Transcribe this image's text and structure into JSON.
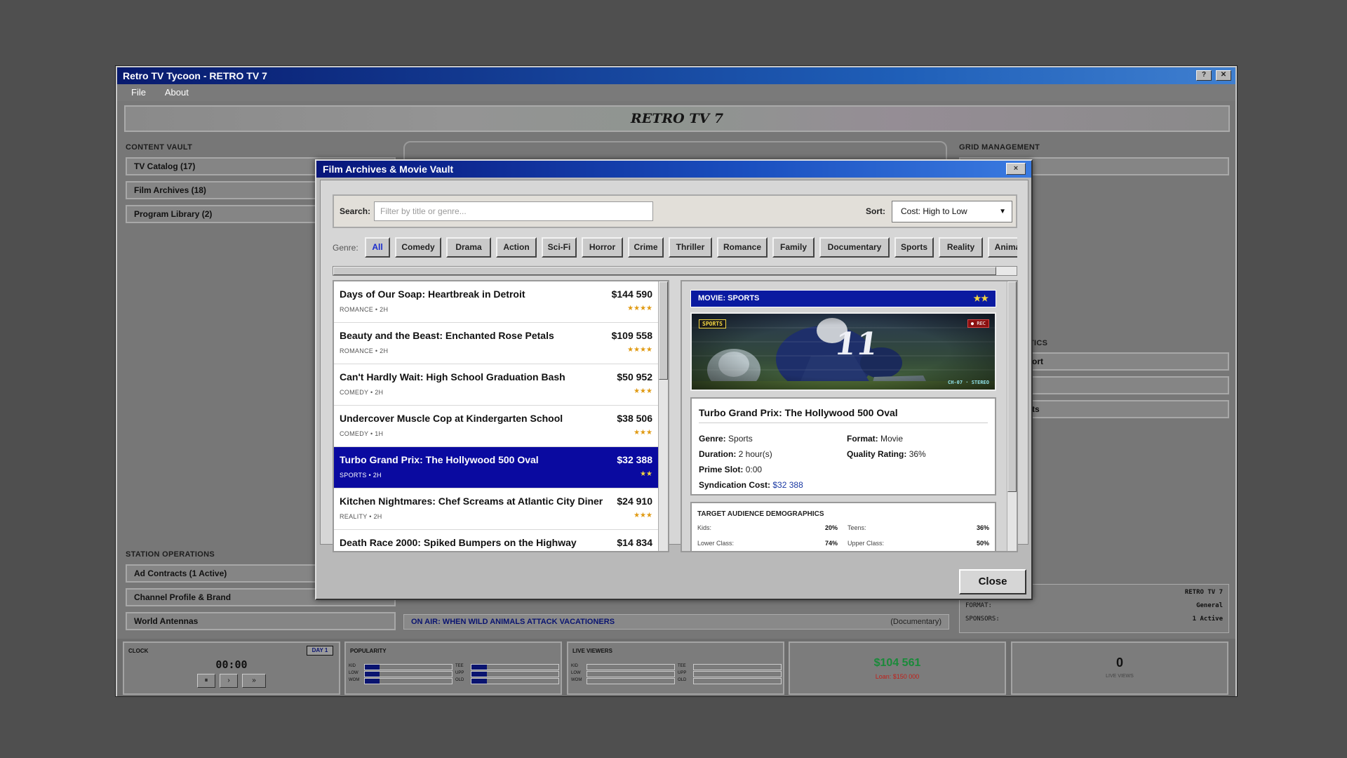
{
  "window": {
    "title": "Retro TV Tycoon - RETRO TV 7"
  },
  "menu": [
    "File",
    "About"
  ],
  "banner": {
    "title": "RETRO TV 7"
  },
  "content_vault": {
    "heading": "CONTENT VAULT",
    "items": [
      "TV Catalog (17)",
      "Film Archives (18)",
      "Program Library (2)"
    ]
  },
  "grid_management": {
    "heading": "GRID MANAGEMENT"
  },
  "statistics": {
    "heading_fragment": "TICS",
    "item1": "ort",
    "item3": "ts"
  },
  "station_operations": {
    "heading": "STATION OPERATIONS",
    "items": [
      "Ad Contracts (1 Active)",
      "Channel Profile & Brand",
      "World Antennas"
    ]
  },
  "on_air": {
    "text": "ON AIR: WHEN WILD ANIMALS ATTACK VACATIONERS",
    "category": "(Documentary)"
  },
  "station_info": {
    "name_value": "RETRO TV 7",
    "format_label": "FORMAT:",
    "format_value": "General",
    "sponsors_label": "SPONSORS:",
    "sponsors_value": "1 Active"
  },
  "status": {
    "clock": {
      "label": "CLOCK",
      "day": "DAY 1",
      "time": "00:00",
      "controls": [
        "⏸",
        "›",
        "»"
      ]
    },
    "popularity": {
      "label": "POPULARITY",
      "bars": [
        {
          "label": "KID",
          "level": 0.17
        },
        {
          "label": "TEE",
          "level": 0.18
        },
        {
          "label": "LOW",
          "level": 0.17
        },
        {
          "label": "UPP",
          "level": 0.18
        },
        {
          "label": "WOM",
          "level": 0.17
        },
        {
          "label": "OLD",
          "level": 0.18
        }
      ]
    },
    "live_viewers": {
      "label": "LIVE VIEWERS",
      "bars": [
        {
          "label": "KID",
          "level": 0
        },
        {
          "label": "TEE",
          "level": 0
        },
        {
          "label": "LOW",
          "level": 0
        },
        {
          "label": "UPP",
          "level": 0
        },
        {
          "label": "WOM",
          "level": 0
        },
        {
          "label": "OLD",
          "level": 0
        }
      ]
    },
    "money": {
      "value": "$104 561",
      "loan": "Loan: $150 000"
    },
    "views": {
      "value": "0",
      "label": "LIVE VIEWS"
    }
  },
  "modal": {
    "title": "Film Archives & Movie Vault",
    "close_x": "×",
    "search_label": "Search:",
    "search_placeholder": "Filter by title or genre...",
    "sort_label": "Sort:",
    "sort_value": "Cost: High to Low",
    "genre_label": "Genre:",
    "genres": [
      "All",
      "Comedy",
      "Drama",
      "Action",
      "Sci-Fi",
      "Horror",
      "Crime",
      "Thriller",
      "Romance",
      "Family",
      "Documentary",
      "Sports",
      "Reality",
      "Animat"
    ],
    "active_genre": "All",
    "films": [
      {
        "title": "Days of Our Soap: Heartbreak in Detroit",
        "meta": "ROMANCE • 2H",
        "price": "$144 590",
        "stars": "★★★★"
      },
      {
        "title": "Beauty and the Beast: Enchanted Rose Petals",
        "meta": "ROMANCE • 2H",
        "price": "$109 558",
        "stars": "★★★★"
      },
      {
        "title": "Can't Hardly Wait: High School Graduation Bash",
        "meta": "COMEDY • 2H",
        "price": "$50 952",
        "stars": "★★★"
      },
      {
        "title": "Undercover Muscle Cop at Kindergarten School",
        "meta": "COMEDY • 1H",
        "price": "$38 506",
        "stars": "★★★"
      },
      {
        "title": "Turbo Grand Prix: The Hollywood 500 Oval",
        "meta": "SPORTS • 2H",
        "price": "$32 388",
        "stars": "★★"
      },
      {
        "title": "Kitchen Nightmares: Chef Screams at Atlantic City Diner",
        "meta": "REALITY • 2H",
        "price": "$24 910",
        "stars": "★★★"
      },
      {
        "title": "Death Race 2000: Spiked Bumpers on the Highway",
        "meta": "",
        "price": "$14 834",
        "stars": ""
      }
    ],
    "selected_index": 4,
    "detail": {
      "header": "MOVIE: SPORTS",
      "stars": "★★",
      "image_tag": "SPORTS",
      "image_rec": "● REC",
      "image_channel": "CH-07 · STEREO",
      "jersey_number": "11",
      "name": "Turbo Grand Prix: The Hollywood 500 Oval",
      "genre_label": "Genre:",
      "genre": "Sports",
      "format_label": "Format:",
      "format": "Movie",
      "duration_label": "Duration:",
      "duration": "2 hour(s)",
      "quality_label": "Quality Rating:",
      "quality": "36%",
      "prime_label": "Prime Slot:",
      "prime": "0:00",
      "cost_label": "Syndication Cost:",
      "cost": "$32 388",
      "demographics_heading": "TARGET AUDIENCE DEMOGRAPHICS",
      "demographics": [
        {
          "label": "Kids:",
          "value": "20%"
        },
        {
          "label": "Teens:",
          "value": "36%"
        },
        {
          "label": "Lower Class:",
          "value": "74%"
        },
        {
          "label": "Upper Class:",
          "value": "50%"
        }
      ]
    },
    "close_button": "Close"
  },
  "colors": {
    "accent_blue": "#0a0aa0",
    "money_green": "#1a8a3a",
    "loan_red": "#c0201a",
    "star_gold": "#e09a12"
  }
}
